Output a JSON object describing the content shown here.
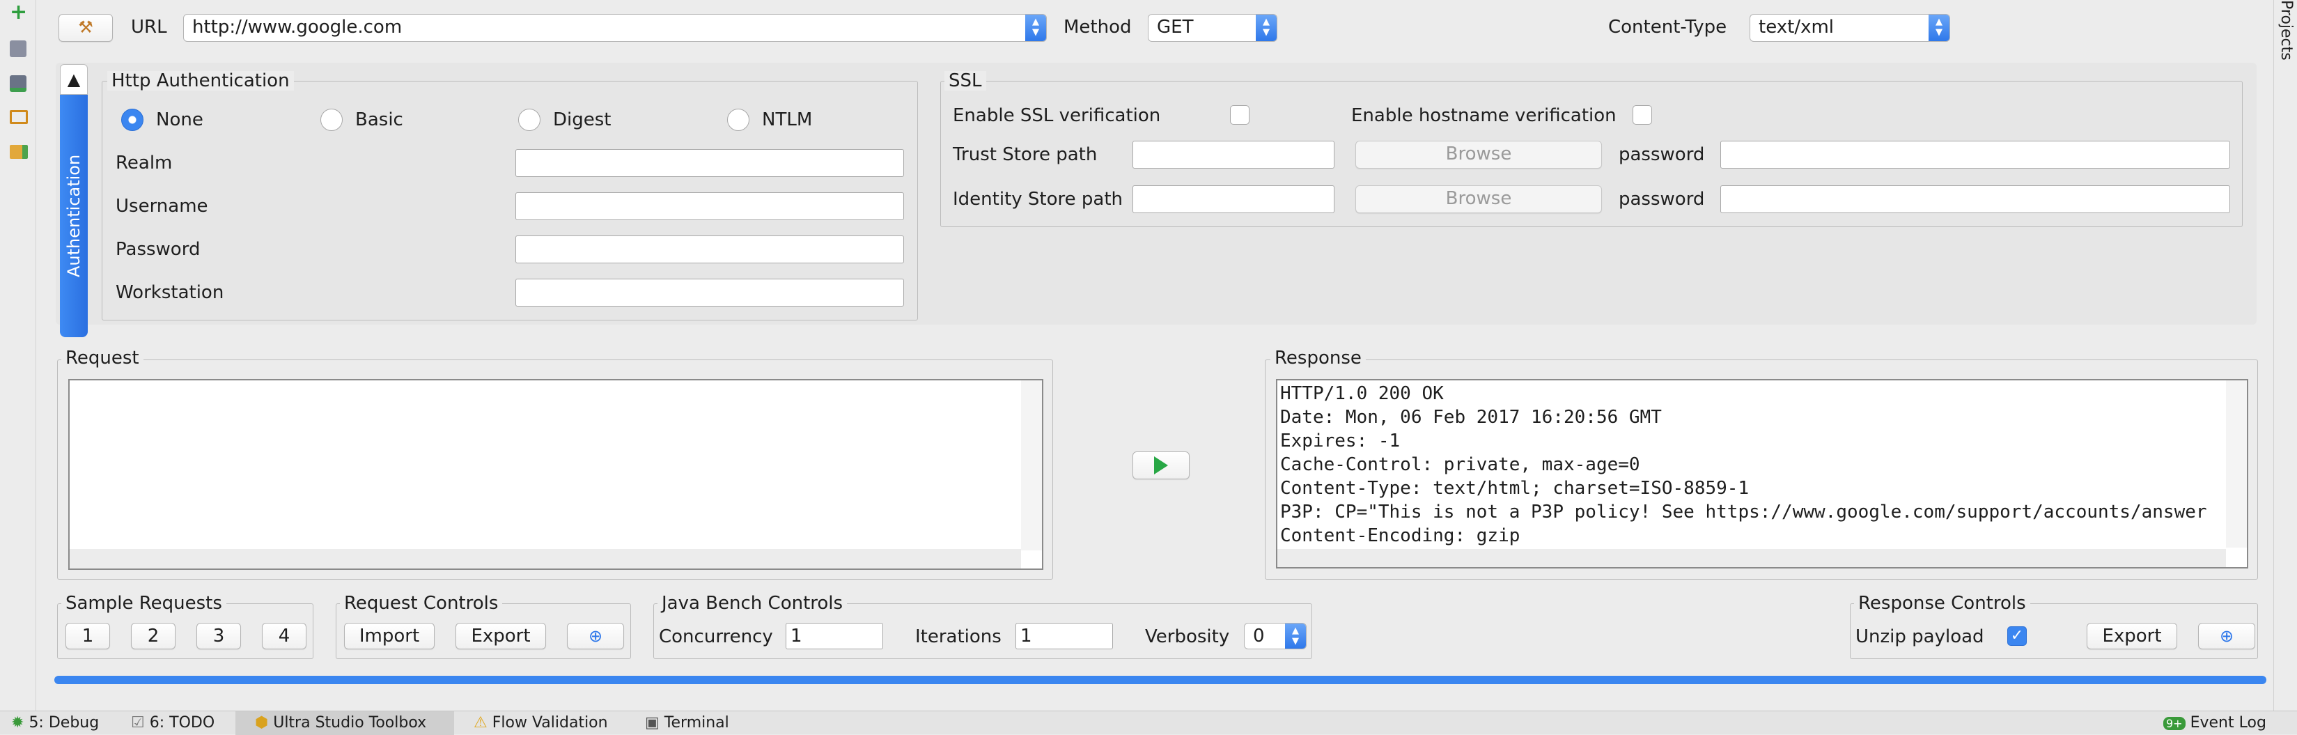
{
  "toolbar_left": {
    "icons": [
      "plus-icon",
      "save-icon",
      "save-as-icon",
      "open-folder-icon",
      "project-folder-icon"
    ]
  },
  "top": {
    "url_label": "URL",
    "url_value": "http://www.google.com",
    "method_label": "Method",
    "method_value": "GET",
    "content_type_label": "Content-Type",
    "content_type_value": "text/xml"
  },
  "right_strip": {
    "label": "Projects"
  },
  "auth_tab": {
    "label": "Authentication",
    "collapse_glyph": "▲"
  },
  "http_auth": {
    "title": "Http Authentication",
    "options": [
      "None",
      "Basic",
      "Digest",
      "NTLM"
    ],
    "selected": "None",
    "realm_label": "Realm",
    "username_label": "Username",
    "password_label": "Password",
    "workstation_label": "Workstation",
    "realm_value": "",
    "username_value": "",
    "password_value": "",
    "workstation_value": ""
  },
  "ssl": {
    "title": "SSL",
    "enable_ssl_label": "Enable SSL verification",
    "enable_hostname_label": "Enable hostname verification",
    "trust_store_label": "Trust Store path",
    "identity_store_label": "Identity Store path",
    "browse_label": "Browse",
    "password_label": "password"
  },
  "request": {
    "title": "Request",
    "body": ""
  },
  "response": {
    "title": "Response",
    "lines": [
      "HTTP/1.0 200 OK",
      "Date: Mon, 06 Feb 2017 16:20:56 GMT",
      "Expires: -1",
      "Cache-Control: private, max-age=0",
      "Content-Type: text/html; charset=ISO-8859-1",
      "P3P: CP=\"This is not a P3P policy! See https://www.google.com/support/accounts/answer",
      "Content-Encoding: gzip"
    ]
  },
  "sample_requests": {
    "title": "Sample Requests",
    "buttons": [
      "1",
      "2",
      "3",
      "4"
    ]
  },
  "request_controls": {
    "title": "Request Controls",
    "import_label": "Import",
    "export_label": "Export"
  },
  "bench": {
    "title": "Java Bench Controls",
    "concurrency_label": "Concurrency",
    "concurrency_value": "1",
    "iterations_label": "Iterations",
    "iterations_value": "1",
    "verbosity_label": "Verbosity",
    "verbosity_value": "0"
  },
  "response_controls": {
    "title": "Response Controls",
    "unzip_label": "Unzip payload",
    "unzip_checked": true,
    "export_label": "Export"
  },
  "progress": {
    "value": 1.0,
    "color": "#3b86f0"
  },
  "statusbar": {
    "debug": "5: Debug",
    "todo": "6: TODO",
    "toolbox": "Ultra Studio Toolbox",
    "flow": "Flow Validation",
    "terminal": "Terminal",
    "event_badge": "9+",
    "event_log": "Event Log"
  },
  "colors": {
    "accent": "#3b86f0",
    "run_green": "#28a745"
  }
}
